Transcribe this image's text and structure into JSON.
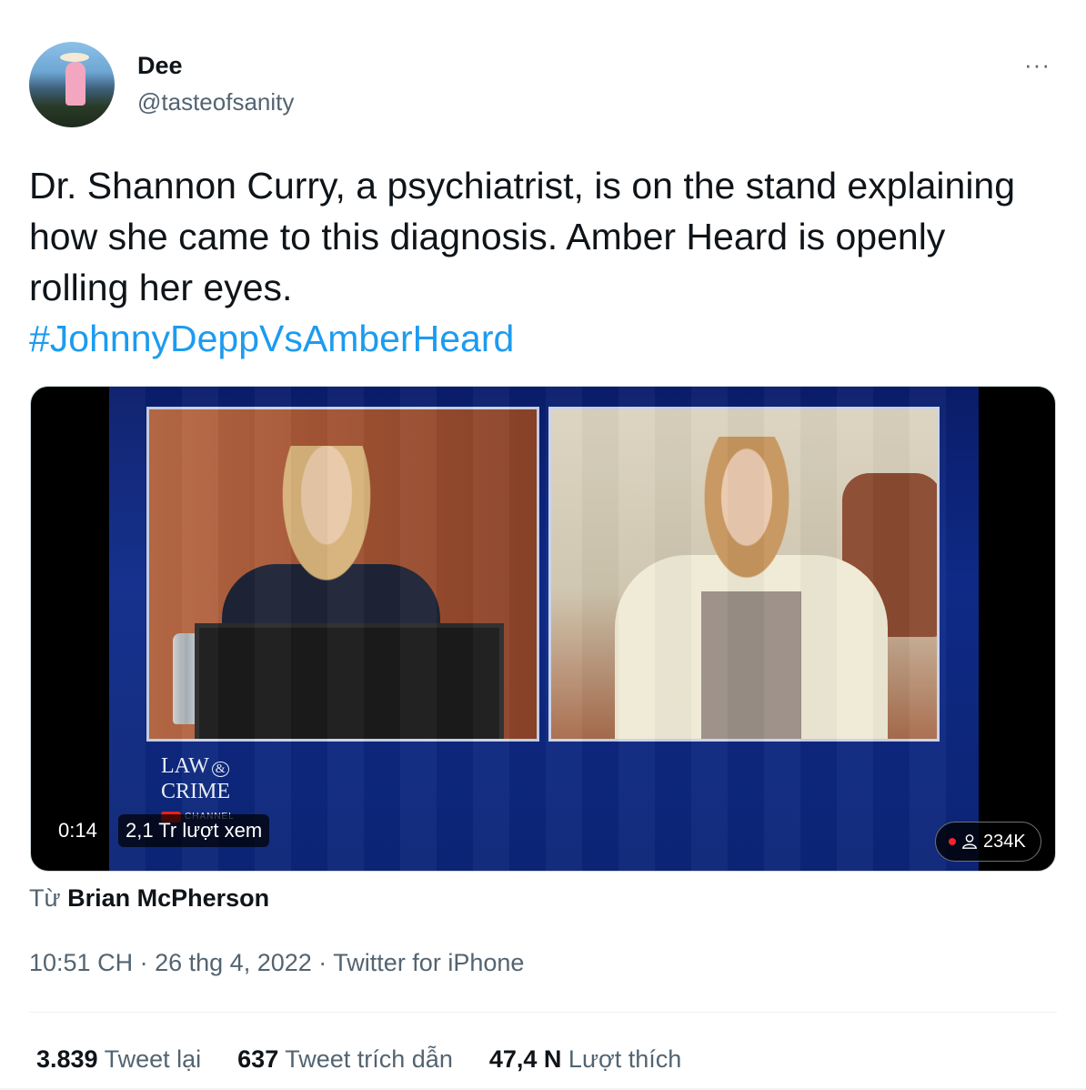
{
  "tweet": {
    "author_name": "Dee",
    "author_handle": "@tasteofsanity",
    "more_label": "···",
    "text": "Dr. Shannon Curry, a psychiatrist, is on the stand explaining how she came to this diagnosis. Amber Heard is openly rolling her eyes.",
    "hashtag": "#JohnnyDeppVsAmberHeard"
  },
  "video": {
    "logo_line1": "LAW",
    "logo_amp": "&",
    "logo_line2": "CRIME",
    "logo_channel": "CHANNEL",
    "timestamp": "0:14",
    "views": "2,1 Tr lượt xem",
    "live_viewers": "234K"
  },
  "attribution": {
    "prefix": "Từ",
    "source_name": "Brian McPherson"
  },
  "meta": {
    "time": "10:51 CH",
    "sep1": "·",
    "date": "26 thg 4, 2022",
    "sep2": "·",
    "client": "Twitter for iPhone"
  },
  "stats": {
    "retweets_count": "3.839",
    "retweets_label": "Tweet lại",
    "quotes_count": "637",
    "quotes_label": "Tweet trích dẫn",
    "likes_count": "47,4 N",
    "likes_label": "Lượt thích"
  },
  "colors": {
    "link": "#1d9bf0",
    "secondary_text": "#536471",
    "primary_text": "#0f1419",
    "live_dot": "#f4212e"
  }
}
